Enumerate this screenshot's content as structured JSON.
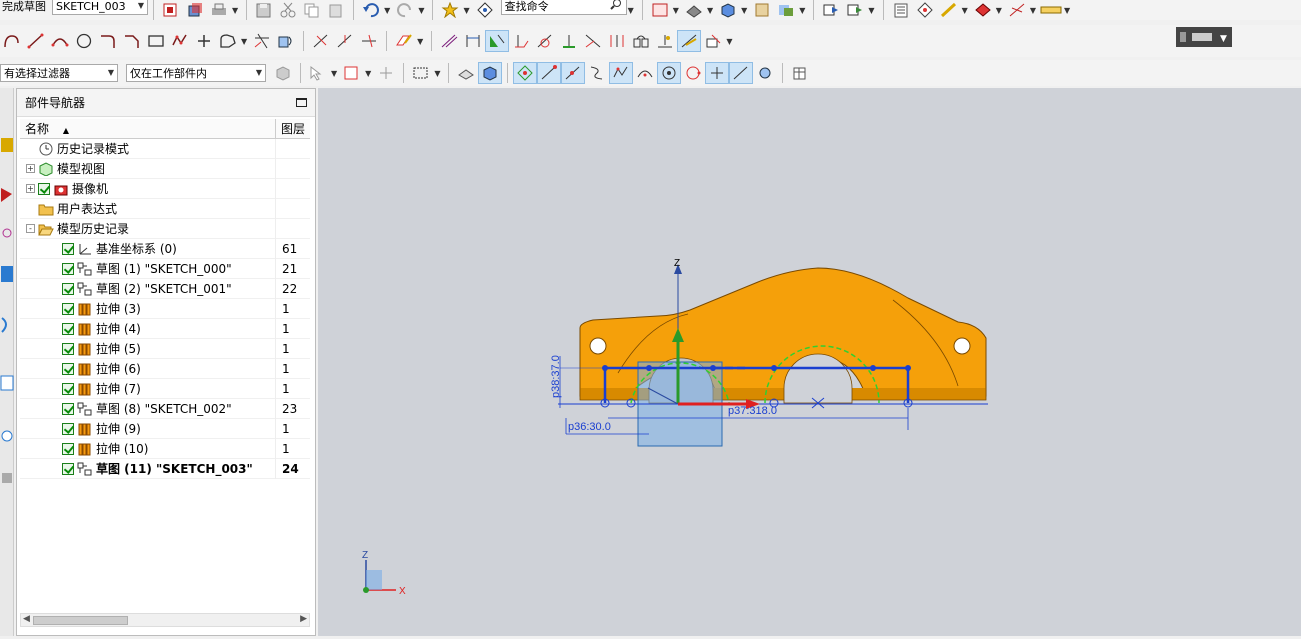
{
  "toolbar": {
    "finish_sketch_label": "完成草图",
    "sketch_name": "SKETCH_003",
    "command_search_placeholder": "查找命令"
  },
  "selection_bar": {
    "filter_label": "有选择过滤器",
    "scope_label": "仅在工作部件内"
  },
  "navigator": {
    "title": "部件导航器",
    "col_name": "名称",
    "col_layer": "图层",
    "items": [
      {
        "label": "历史记录模式",
        "layer": "",
        "icon": "clock-icon",
        "indent": 0,
        "expander": "",
        "check": false
      },
      {
        "label": "模型视图",
        "layer": "",
        "icon": "model-view-icon",
        "indent": 0,
        "expander": "+",
        "check": false
      },
      {
        "label": "摄像机",
        "layer": "",
        "icon": "camera-icon",
        "indent": 0,
        "expander": "+",
        "check": true
      },
      {
        "label": "用户表达式",
        "layer": "",
        "icon": "folder-icon",
        "indent": 0,
        "expander": "",
        "check": false
      },
      {
        "label": "模型历史记录",
        "layer": "",
        "icon": "folder-open-icon",
        "indent": 0,
        "expander": "-",
        "check": false
      },
      {
        "label": "基准坐标系 (0)",
        "layer": "61",
        "icon": "datum-csys-icon",
        "indent": 1,
        "expander": "",
        "check": true
      },
      {
        "label": "草图 (1) \"SKETCH_000\"",
        "layer": "21",
        "icon": "sketch-icon",
        "indent": 1,
        "expander": "",
        "check": true
      },
      {
        "label": "草图 (2) \"SKETCH_001\"",
        "layer": "22",
        "icon": "sketch-icon",
        "indent": 1,
        "expander": "",
        "check": true
      },
      {
        "label": "拉伸 (3)",
        "layer": "1",
        "icon": "extrude-icon",
        "indent": 1,
        "expander": "",
        "check": true
      },
      {
        "label": "拉伸 (4)",
        "layer": "1",
        "icon": "extrude-icon",
        "indent": 1,
        "expander": "",
        "check": true
      },
      {
        "label": "拉伸 (5)",
        "layer": "1",
        "icon": "extrude-icon",
        "indent": 1,
        "expander": "",
        "check": true
      },
      {
        "label": "拉伸 (6)",
        "layer": "1",
        "icon": "extrude-icon",
        "indent": 1,
        "expander": "",
        "check": true
      },
      {
        "label": "拉伸 (7)",
        "layer": "1",
        "icon": "extrude-icon",
        "indent": 1,
        "expander": "",
        "check": true
      },
      {
        "label": "草图 (8) \"SKETCH_002\"",
        "layer": "23",
        "icon": "sketch-icon",
        "indent": 1,
        "expander": "",
        "check": true
      },
      {
        "label": "拉伸 (9)",
        "layer": "1",
        "icon": "extrude-icon",
        "indent": 1,
        "expander": "",
        "check": true
      },
      {
        "label": "拉伸 (10)",
        "layer": "1",
        "icon": "extrude-icon",
        "indent": 1,
        "expander": "",
        "check": true
      },
      {
        "label": "草图 (11) \"SKETCH_003\"",
        "layer": "24",
        "icon": "sketch-icon",
        "indent": 1,
        "expander": "",
        "check": true,
        "bold": true
      }
    ]
  },
  "viewport": {
    "dimensions": {
      "height_dim": "p38:37.0",
      "width_dim": "p37:318.0",
      "radius_dim": "p36:30.0"
    },
    "axis_labels": {
      "z": "Z",
      "x": "X",
      "mini_z": "Z",
      "mini_x": "X"
    }
  },
  "colors": {
    "part": "#f5a00a",
    "part_edge": "#7a4a00",
    "sketch_line": "#1a3fd0",
    "constraint_green": "#30d030",
    "viewport_bg": "#cfd2d8",
    "axis_x": "#e02020",
    "axis_z": "#2a9a2a"
  }
}
